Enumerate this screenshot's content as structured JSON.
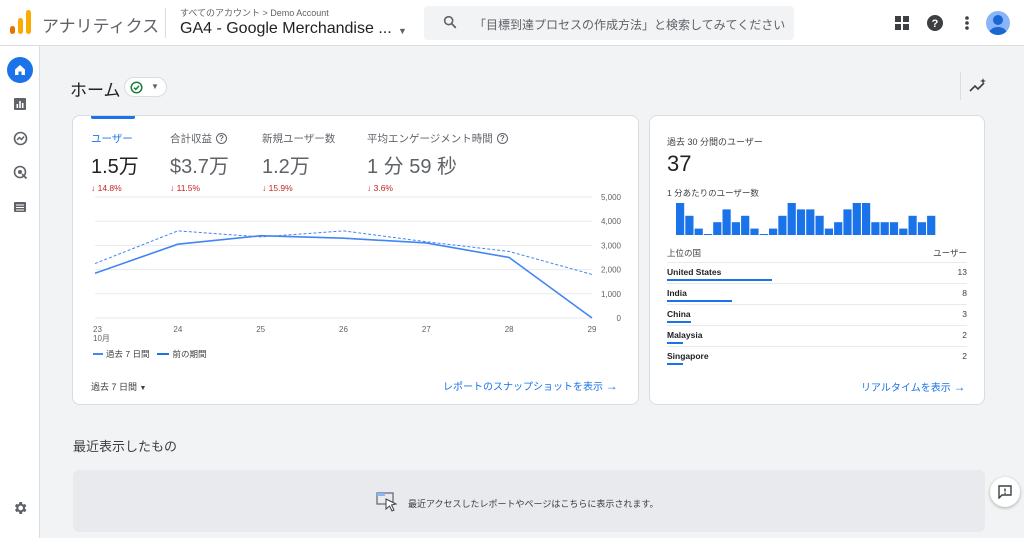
{
  "header": {
    "app_name": "アナリティクス",
    "breadcrumb": "すべてのアカウント > Demo Account",
    "property": "GA4 - Google Merchandise ...",
    "search_placeholder": "「目標到達プロセスの作成方法」と検索してみてください",
    "icons": [
      "apps-grid-icon",
      "help-icon",
      "more-vert-icon",
      "account-avatar"
    ]
  },
  "nav": {
    "items": [
      "home-icon",
      "reports-icon",
      "explore-icon",
      "advertising-icon",
      "configure-icon"
    ],
    "bottom": "settings-icon"
  },
  "home": {
    "title": "ホーム",
    "status": "check-circle-icon"
  },
  "metrics": [
    {
      "label": "ユーザー",
      "value": "1.5万",
      "delta": "↓ 14.8%",
      "selected": true,
      "help": false
    },
    {
      "label": "合計収益",
      "value": "$3.7万",
      "delta": "↓ 11.5%",
      "selected": false,
      "help": true
    },
    {
      "label": "新規ユーザー数",
      "value": "1.2万",
      "delta": "↓ 15.9%",
      "selected": false,
      "help": false
    },
    {
      "label": "平均エンゲージメント時間",
      "value": "1 分 59 秒",
      "delta": "↓ 3.6%",
      "selected": false,
      "help": true
    }
  ],
  "chart_data": {
    "type": "line",
    "x": [
      "23",
      "24",
      "25",
      "26",
      "27",
      "28",
      "29"
    ],
    "x_sublabel": "10月",
    "series": [
      {
        "name": "過去 7 日間",
        "values": [
          1850,
          3050,
          3400,
          3300,
          3100,
          2500,
          0
        ],
        "color": "#4285f4",
        "style": "solid"
      },
      {
        "name": "前の期間",
        "values": [
          2250,
          3600,
          3350,
          3600,
          3150,
          2750,
          1800
        ],
        "color": "#4285f4",
        "style": "dashed"
      }
    ],
    "y_ticks": [
      "5,000",
      "4,000",
      "3,000",
      "2,000",
      "1,000",
      "0"
    ],
    "ylim": [
      0,
      5000
    ],
    "grid": true,
    "legend_position": "bottom-left"
  },
  "main_card": {
    "period": "過去 7 日間",
    "link": "レポートのスナップショットを表示"
  },
  "realtime": {
    "title": "過去 30 分間のユーザー",
    "value": "37",
    "subtitle": "1 分あたりのユーザー数",
    "minute_bars": [
      5,
      3,
      1,
      0,
      2,
      4,
      2,
      3,
      1,
      0,
      1,
      3,
      5,
      4,
      4,
      3,
      1,
      2,
      4,
      5,
      5,
      2,
      2,
      2,
      1,
      3,
      2,
      3
    ],
    "col_country": "上位の国",
    "col_users": "ユーザー",
    "countries": [
      {
        "name": "United States",
        "users": "13",
        "share": 1.0
      },
      {
        "name": "India",
        "users": "8",
        "share": 0.62
      },
      {
        "name": "China",
        "users": "3",
        "share": 0.23
      },
      {
        "name": "Malaysia",
        "users": "2",
        "share": 0.15
      },
      {
        "name": "Singapore",
        "users": "2",
        "share": 0.15
      }
    ],
    "link": "リアルタイムを表示"
  },
  "recent": {
    "title": "最近表示したもの",
    "empty_message": "最近アクセスしたレポートやページはこちらに表示されます。"
  },
  "colors": {
    "accent": "#1a73e8",
    "negative": "#c5221f",
    "logo_orange": "#f9ab00",
    "logo_dark": "#e37400"
  }
}
